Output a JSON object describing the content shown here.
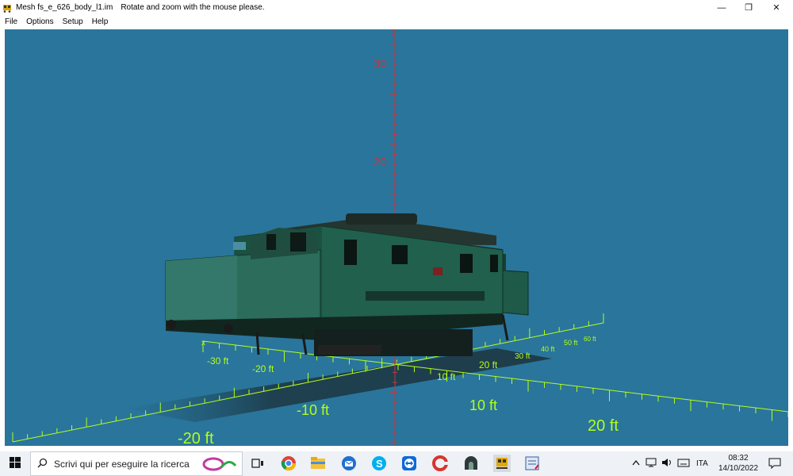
{
  "window": {
    "title": "Mesh fs_e_626_body_l1.im",
    "hint": "Rotate and zoom with the mouse please.",
    "controls": {
      "minimize": "—",
      "maximize": "❐",
      "close": "✕"
    }
  },
  "menu": [
    "File",
    "Options",
    "Setup",
    "Help"
  ],
  "viewport": {
    "background": "#2a759b",
    "z_axis": {
      "label": "z",
      "ticks": [
        "30",
        "20"
      ]
    },
    "x_axis": {
      "label": "x",
      "ticks": [
        "-30 ft",
        "-20 ft"
      ]
    },
    "ground_axis": {
      "ticks": [
        "30 ft",
        "40 ft",
        "50 ft",
        "60 ft",
        "20 ft",
        "10 ft",
        "-10 ft",
        "10 ft",
        "20 ft",
        "-20 ft"
      ]
    }
  },
  "taskbar": {
    "search_placeholder": "Scrivi qui per eseguire la ricerca",
    "language": "ITA",
    "time": "08:32",
    "date": "14/10/2022"
  }
}
